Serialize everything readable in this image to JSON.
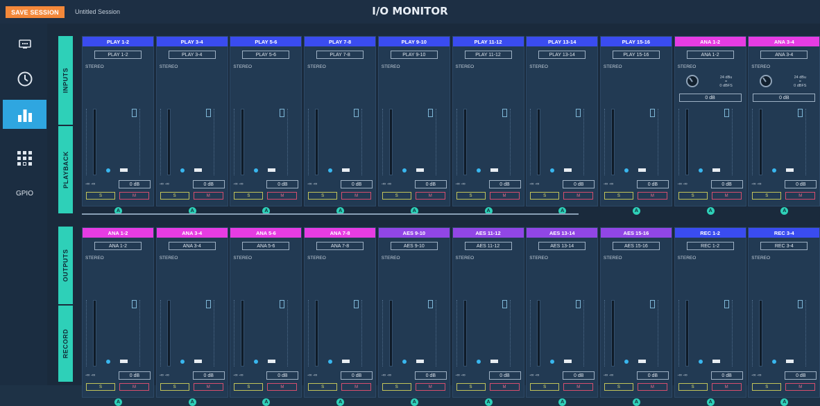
{
  "header": {
    "save_label": "SAVE SESSION",
    "session_name": "Untitled Session",
    "title": "I/O MONITOR",
    "save_color": "#f3883a"
  },
  "nav": {
    "items": [
      {
        "icon": "monitor-icon"
      },
      {
        "icon": "clock-icon"
      },
      {
        "icon": "meter-bars-icon",
        "active": true
      },
      {
        "icon": "matrix-grid-icon"
      },
      {
        "label": "GPIO"
      }
    ],
    "active_color": "#2fa6e0"
  },
  "sections": {
    "top": {
      "tab1": "INPUTS",
      "tab2": "PLAYBACK"
    },
    "bottom": {
      "tab1": "OUTPUTS",
      "tab2": "RECORD"
    },
    "tab_color": "#2ed0b8"
  },
  "colors": {
    "play": "#3a4cf0",
    "ana": "#e63ce3",
    "aes": "#9146e6",
    "rec": "#3a4cf0"
  },
  "strip_defaults": {
    "mode": "STEREO",
    "level": "0 dB",
    "pan": "-∞  -∞",
    "solo": "S",
    "mute": "M",
    "link_icon": "A"
  },
  "strips_top": [
    {
      "header": "PLAY 1-2",
      "name": "PLAY 1-2",
      "color": "play"
    },
    {
      "header": "PLAY 3-4",
      "name": "PLAY 3-4",
      "color": "play"
    },
    {
      "header": "PLAY 5-6",
      "name": "PLAY 5-6",
      "color": "play"
    },
    {
      "header": "PLAY 7-8",
      "name": "PLAY 7-8",
      "color": "play"
    },
    {
      "header": "PLAY 9-10",
      "name": "PLAY 9-10",
      "color": "play"
    },
    {
      "header": "PLAY 11-12",
      "name": "PLAY 11-12",
      "color": "play"
    },
    {
      "header": "PLAY 13-14",
      "name": "PLAY 13-14",
      "color": "play"
    },
    {
      "header": "PLAY 15-16",
      "name": "PLAY 15-16",
      "color": "play"
    },
    {
      "header": "ANA 1-2",
      "name": "ANA 1-2",
      "color": "ana",
      "gain": "0 dB",
      "gain_info": "24 dBu\n=\n0 dBFS"
    },
    {
      "header": "ANA 3-4",
      "name": "ANA 3-4",
      "color": "ana",
      "gain": "0 dB",
      "gain_info": "24 dBu\n=\n0 dBFS"
    }
  ],
  "strips_bottom": [
    {
      "header": "ANA 1-2",
      "name": "ANA 1-2",
      "color": "ana"
    },
    {
      "header": "ANA 3-4",
      "name": "ANA 3-4",
      "color": "ana"
    },
    {
      "header": "ANA 5-6",
      "name": "ANA 5-6",
      "color": "ana"
    },
    {
      "header": "ANA 7-8",
      "name": "ANA 7-8",
      "color": "ana"
    },
    {
      "header": "AES 9-10",
      "name": "AES 9-10",
      "color": "aes"
    },
    {
      "header": "AES 11-12",
      "name": "AES 11-12",
      "color": "aes"
    },
    {
      "header": "AES 13-14",
      "name": "AES 13-14",
      "color": "aes"
    },
    {
      "header": "AES 15-16",
      "name": "AES 15-16",
      "color": "aes"
    },
    {
      "header": "REC 1-2",
      "name": "REC 1-2",
      "color": "rec"
    },
    {
      "header": "REC 3-4",
      "name": "REC 3-4",
      "color": "rec"
    }
  ]
}
